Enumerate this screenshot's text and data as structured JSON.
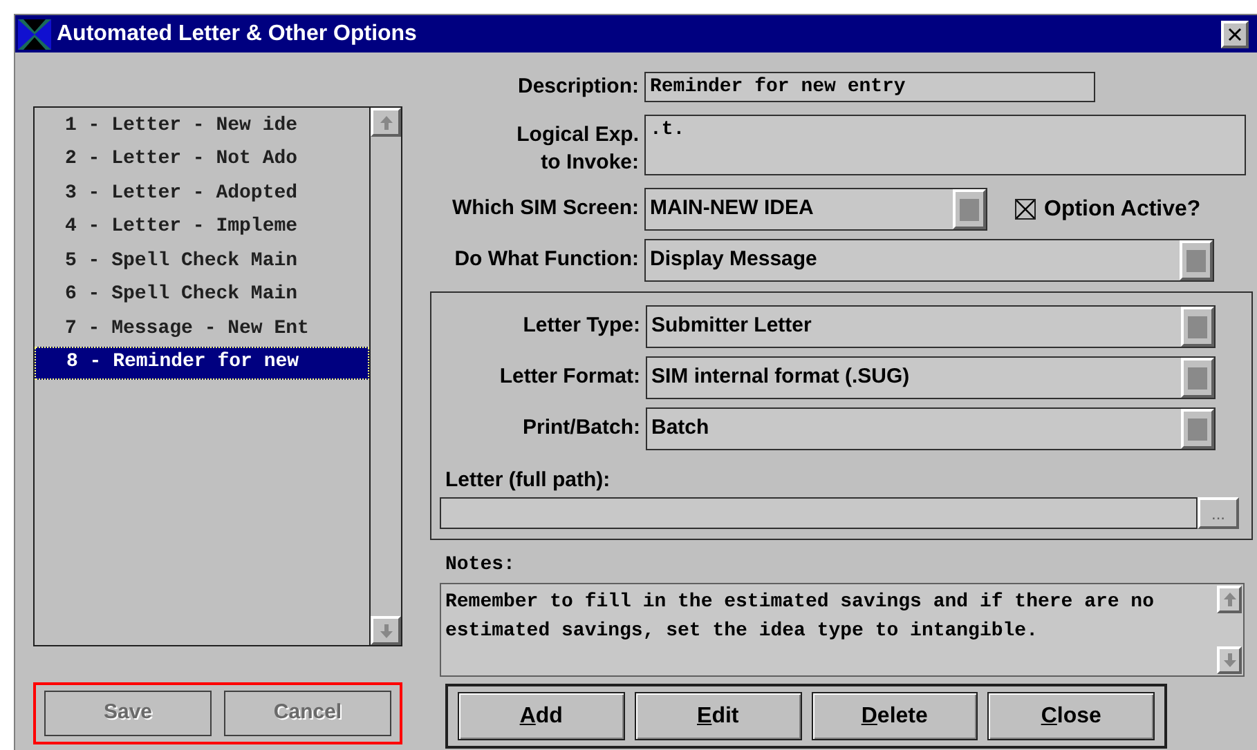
{
  "window": {
    "title": "Automated Letter & Other Options"
  },
  "list": {
    "items": [
      {
        "label": "1 - Letter - New ide",
        "selected": false
      },
      {
        "label": "2 - Letter - Not Ado",
        "selected": false
      },
      {
        "label": "3 - Letter - Adopted",
        "selected": false
      },
      {
        "label": "4 - Letter - Impleme",
        "selected": false
      },
      {
        "label": "5 - Spell Check Main",
        "selected": false
      },
      {
        "label": "6 - Spell Check Main",
        "selected": false
      },
      {
        "label": "7 - Message - New Ent",
        "selected": false
      },
      {
        "label": "8 - Reminder for new",
        "selected": true
      }
    ]
  },
  "form": {
    "description": {
      "label": "Description:",
      "value": "Reminder for new entry"
    },
    "logical_exp": {
      "label_lines": [
        "Logical Exp.",
        "to Invoke:"
      ],
      "value": ".t."
    },
    "sim_screen": {
      "label": "Which SIM Screen:",
      "value": "MAIN-NEW IDEA"
    },
    "option_active": {
      "label": "Option Active?",
      "checked": true
    },
    "function": {
      "label": "Do What Function:",
      "value": "Display Message"
    }
  },
  "letter_group": {
    "fields": [
      {
        "label": "Letter Type:",
        "value": "Submitter Letter"
      },
      {
        "label": "Letter Format:",
        "value": "SIM internal format (.SUG)"
      },
      {
        "label": "Print/Batch:",
        "value": "Batch"
      }
    ],
    "path": {
      "label": "Letter (full path):",
      "browse": "..."
    }
  },
  "notes": {
    "label": "Notes:",
    "value": "Remember to fill in the estimated savings and if there are no estimated savings, set the idea type to intangible."
  },
  "left_buttons": {
    "highlighted": true,
    "buttons": [
      {
        "label": "Save",
        "disabled": true
      },
      {
        "label": "Cancel",
        "disabled": true
      }
    ]
  },
  "right_buttons": [
    {
      "label": "Add",
      "underline_first": true
    },
    {
      "label": "Edit",
      "underline_first": true
    },
    {
      "label": "Delete",
      "underline_first": true
    },
    {
      "label": "Close",
      "underline_first": true
    }
  ]
}
